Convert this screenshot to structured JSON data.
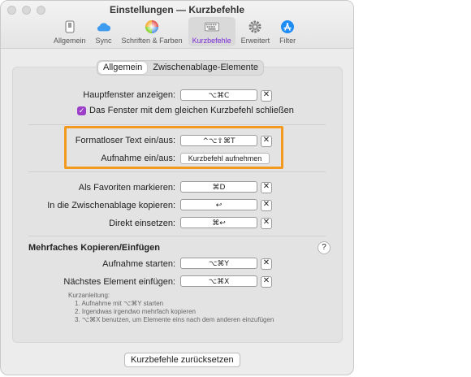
{
  "window": {
    "title": "Einstellungen — Kurzbefehle"
  },
  "toolbar": {
    "items": [
      {
        "label": "Allgemein",
        "icon": "phone-icon"
      },
      {
        "label": "Sync",
        "icon": "cloud-icon"
      },
      {
        "label": "Schriften & Farben",
        "icon": "color-wheel-icon"
      },
      {
        "label": "Kurzbefehle",
        "icon": "keyboard-icon",
        "active": true
      },
      {
        "label": "Erweitert",
        "icon": "gear-icon"
      },
      {
        "label": "Filter",
        "icon": "app-store-icon"
      }
    ]
  },
  "tabs": {
    "general": "Allgemein",
    "clipboard": "Zwischenablage-Elemente"
  },
  "shortcuts": {
    "show_main": {
      "label": "Hauptfenster anzeigen:",
      "value": "⌥⌘C"
    },
    "close_same": {
      "label": "Das Fenster mit dem gleichen Kurzbefehl schließen",
      "checked": true
    },
    "plain_text": {
      "label": "Formatloser Text ein/aus:",
      "value": "^⌥⇧⌘T"
    },
    "recording": {
      "label": "Aufnahme ein/aus:",
      "button": "Kurzbefehl aufnehmen"
    },
    "favorite": {
      "label": "Als Favoriten markieren:",
      "value": "⌘D"
    },
    "copy_clip": {
      "label": "In die Zwischenablage kopieren:",
      "value": "↩"
    },
    "paste_direct": {
      "label": "Direkt einsetzen:",
      "value": "⌘↩"
    }
  },
  "multi": {
    "title": "Mehrfaches Kopieren/Einfügen",
    "help": "?",
    "start": {
      "label": "Aufnahme starten:",
      "value": "⌥⌘Y"
    },
    "next": {
      "label": "Nächstes Element einfügen:",
      "value": "⌥⌘X"
    },
    "hint_title": "Kurzanleitung:",
    "hint_steps": [
      "1. Aufnahme mit ⌥⌘Y starten",
      "2. Irgendwas irgendwo mehrfach kopieren",
      "3. ⌥⌘X benutzen, um Elemente eins nach dem anderen einzufügen"
    ]
  },
  "clear_glyph": "✕",
  "reset_button": "Kurzbefehle zurücksetzen",
  "colors": {
    "accent": "#9b3ec8",
    "highlight": "#f39a1e"
  }
}
